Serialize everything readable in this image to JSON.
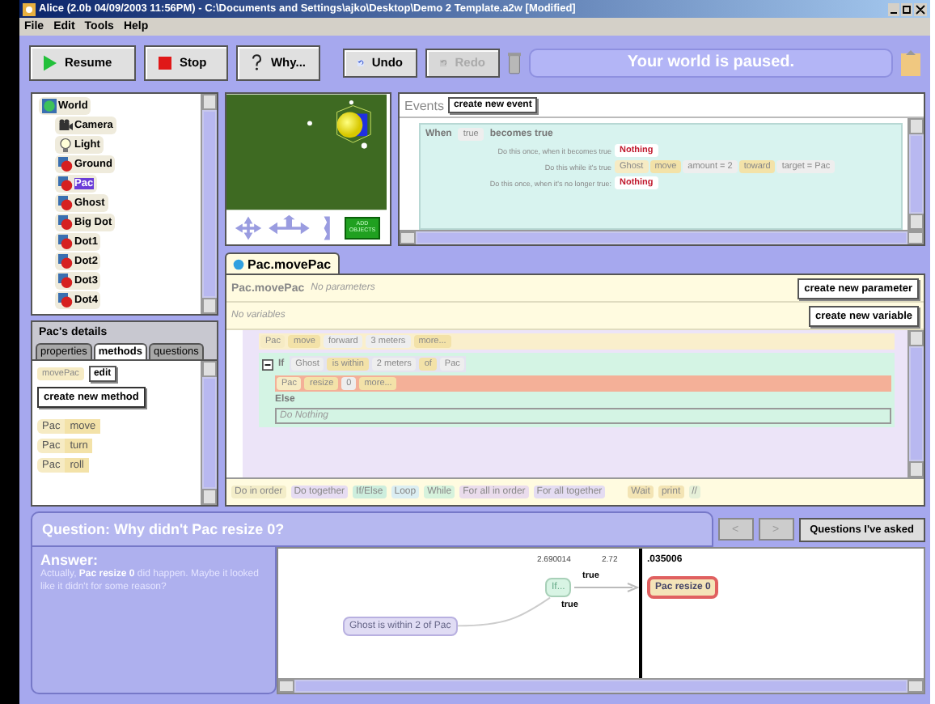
{
  "window": {
    "title": "Alice (2.0b 04/09/2003 11:56PM) - C:\\Documents and Settings\\ajko\\Desktop\\Demo 2 Template.a2w [Modified]"
  },
  "menu": [
    "File",
    "Edit",
    "Tools",
    "Help"
  ],
  "toolbar": {
    "buttons": [
      {
        "label": "Resume",
        "kind": "play",
        "disabled": false
      },
      {
        "label": "Stop",
        "kind": "stop",
        "disabled": false
      },
      {
        "label": "Why...",
        "kind": "why",
        "disabled": false
      },
      {
        "label": "Undo",
        "kind": "undo",
        "disabled": false
      },
      {
        "label": "Redo",
        "kind": "redo",
        "disabled": true
      }
    ],
    "status": "Your world is paused."
  },
  "object_tree": {
    "label": "World",
    "kind": "world",
    "selected": false,
    "children": [
      {
        "label": "Camera",
        "kind": "camera",
        "selected": false
      },
      {
        "label": "Light",
        "kind": "light",
        "selected": false
      },
      {
        "label": "Ground",
        "kind": "object",
        "selected": false
      },
      {
        "label": "Pac",
        "kind": "object",
        "selected": true
      },
      {
        "label": "Ghost",
        "kind": "object",
        "selected": false
      },
      {
        "label": "Big Dot",
        "kind": "object",
        "selected": false
      },
      {
        "label": "Dot1",
        "kind": "object",
        "selected": false
      },
      {
        "label": "Dot2",
        "kind": "object",
        "selected": false
      },
      {
        "label": "Dot3",
        "kind": "object",
        "selected": false
      },
      {
        "label": "Dot4",
        "kind": "object",
        "selected": false
      }
    ]
  },
  "world_view": {
    "add_objects": "ADD OBJECTS"
  },
  "events": {
    "title": "Events",
    "create_button": "create new event",
    "when": "When",
    "condition": "true",
    "trigger": "becomes true",
    "rows": [
      {
        "label": "Do this once, when it becomes true",
        "tiles": [
          {
            "text": "Nothing",
            "kind": "nothing"
          }
        ]
      },
      {
        "label": "Do this while it's true",
        "tiles": [
          {
            "text": "Ghost",
            "kind": "object"
          },
          {
            "text": "move",
            "kind": "method"
          },
          {
            "text": "amount = 2",
            "kind": "param"
          },
          {
            "text": "toward",
            "kind": "method"
          },
          {
            "text": "target = Pac",
            "kind": "param"
          }
        ]
      },
      {
        "label": "Do this once, when it's no longer true:",
        "tiles": [
          {
            "text": "Nothing",
            "kind": "nothing"
          }
        ]
      }
    ]
  },
  "method_tab": {
    "label": "Pac.movePac",
    "selected": true
  },
  "method_header": {
    "name": "Pac.movePac",
    "parameters": "No parameters",
    "variables": "No variables",
    "create_parameter": "create new parameter",
    "create_variable": "create new variable"
  },
  "code": {
    "first_line": {
      "highlighted": false,
      "tiles": [
        {
          "text": "Pac",
          "kind": "object"
        },
        {
          "text": "move",
          "kind": "method"
        },
        {
          "text": "forward",
          "kind": "param"
        },
        {
          "text": "3 meters",
          "kind": "param"
        },
        {
          "text": "more...",
          "kind": "method"
        }
      ]
    },
    "if_label": "If",
    "expanded": true,
    "condition": [
      {
        "text": "Ghost",
        "kind": "param"
      },
      {
        "text": "is within",
        "kind": "method"
      },
      {
        "text": "2 meters",
        "kind": "param"
      },
      {
        "text": "of",
        "kind": "method"
      },
      {
        "text": "Pac",
        "kind": "param"
      }
    ],
    "then_line": {
      "highlighted": true,
      "tiles": [
        {
          "text": "Pac",
          "kind": "object"
        },
        {
          "text": "resize",
          "kind": "method"
        },
        {
          "text": "0",
          "kind": "param"
        },
        {
          "text": "more...",
          "kind": "method"
        }
      ]
    },
    "else_label": "Else",
    "else_body": "Do Nothing"
  },
  "control_tiles": [
    {
      "text": "Do in order",
      "color": "#f3edc8"
    },
    {
      "text": "Do together",
      "color": "#e6dcf2"
    },
    {
      "text": "If/Else",
      "color": "#cdeedd"
    },
    {
      "text": "Loop",
      "color": "#dbeef2"
    },
    {
      "text": "While",
      "color": "#d6f2dc"
    },
    {
      "text": "For all in order",
      "color": "#eadcec"
    },
    {
      "text": "For all together",
      "color": "#e4dcf2"
    },
    {
      "text": "Wait",
      "color": "#f3e4b4"
    },
    {
      "text": "print",
      "color": "#f3e4b4"
    },
    {
      "text": "//",
      "color": "#e6f0d8"
    }
  ],
  "details": {
    "title": "Pac's details",
    "tabs": [
      {
        "label": "properties",
        "selected": false
      },
      {
        "label": "methods",
        "selected": true
      },
      {
        "label": "questions",
        "selected": false
      }
    ],
    "method": "movePac",
    "edit": "edit",
    "create_method": "create new method",
    "tiles": [
      [
        "Pac",
        "move"
      ],
      [
        "Pac",
        "turn"
      ],
      [
        "Pac",
        "roll"
      ]
    ]
  },
  "question": {
    "text": "Question: Why didn't Pac resize  0?",
    "nav": [
      {
        "label": "<",
        "disabled": true
      },
      {
        "label": ">",
        "disabled": true
      }
    ],
    "asked": "Questions I've asked"
  },
  "answer": {
    "title": "Answer:",
    "text": "Actually, **Pac resize 0** did happen. Maybe it looked like it didn't for some reason?"
  },
  "timeline": {
    "ticks": [
      "2.690014",
      "2.72",
      ".035006"
    ],
    "if_node": "If...",
    "action_node": "Pac resize  0",
    "condition_node": "Ghost is within 2 of Pac",
    "labels": [
      "true",
      "true"
    ]
  }
}
